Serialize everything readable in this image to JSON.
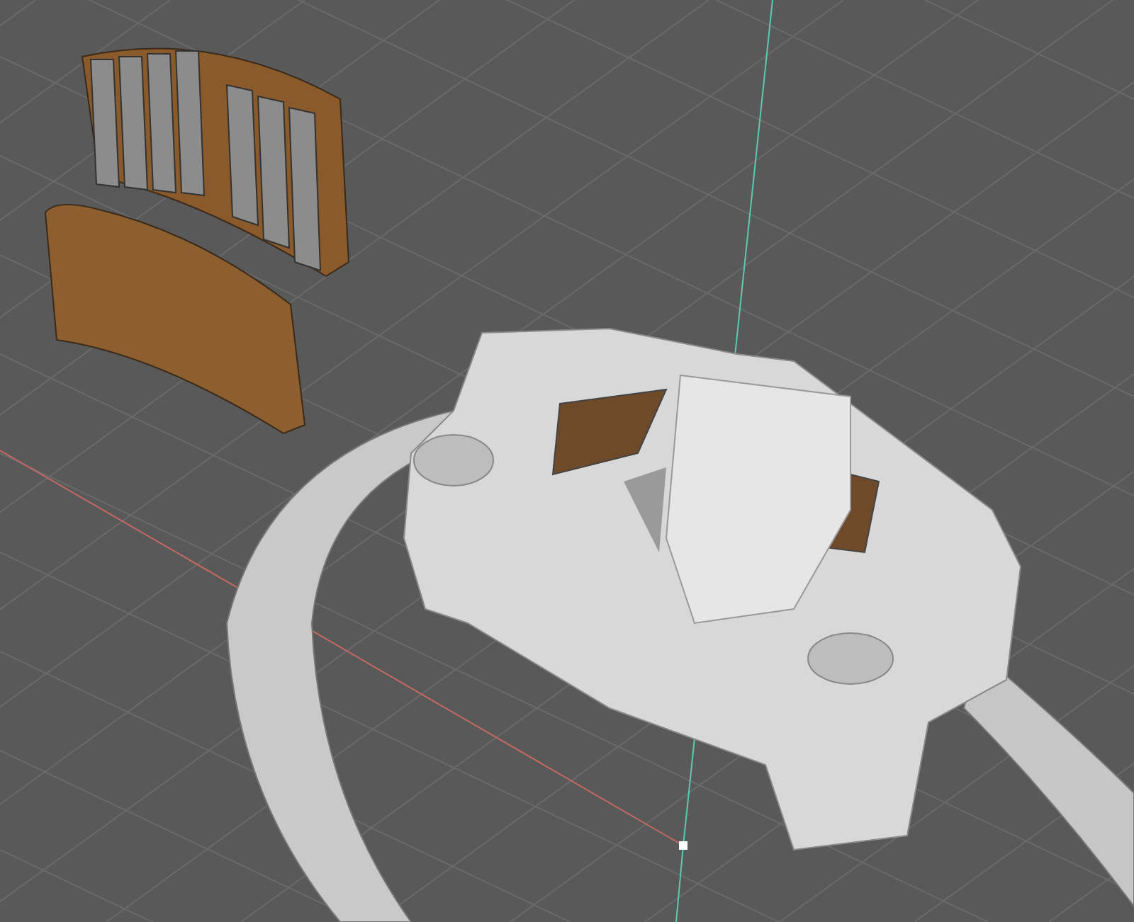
{
  "viewport": {
    "axes": [
      {
        "color": "#c46a62"
      },
      {
        "color": "#5fc9b0"
      }
    ]
  }
}
